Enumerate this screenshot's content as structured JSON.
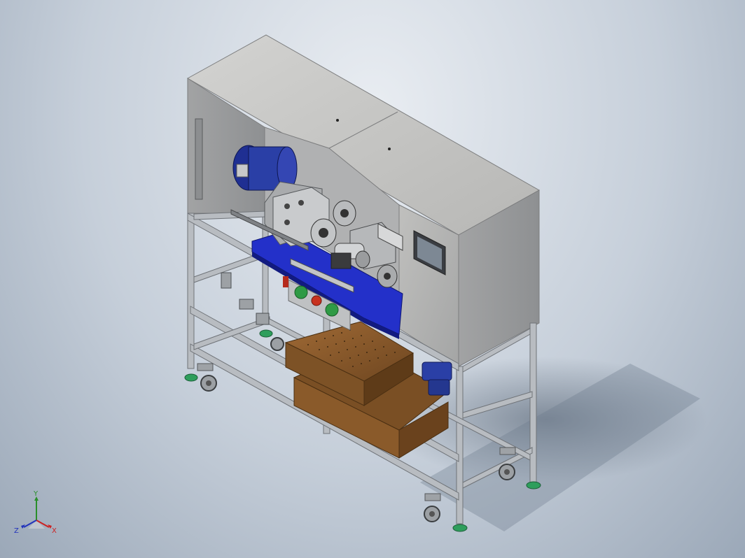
{
  "viewport": {
    "colors": {
      "background_top": "#e9edf2",
      "background_bottom": "#9ba8b8",
      "frame_profile": "#b3b8bf",
      "panel_gray": "#b4b6b8",
      "blue_plate": "#2330c9",
      "motor_blue": "#2a3fa6",
      "wood": "#8a5a2a",
      "foot_green": "#2e9e5c"
    }
  },
  "triad": {
    "y_label": "Y",
    "z_label": "Z",
    "x_label": "X",
    "icon": "triad-icon"
  }
}
